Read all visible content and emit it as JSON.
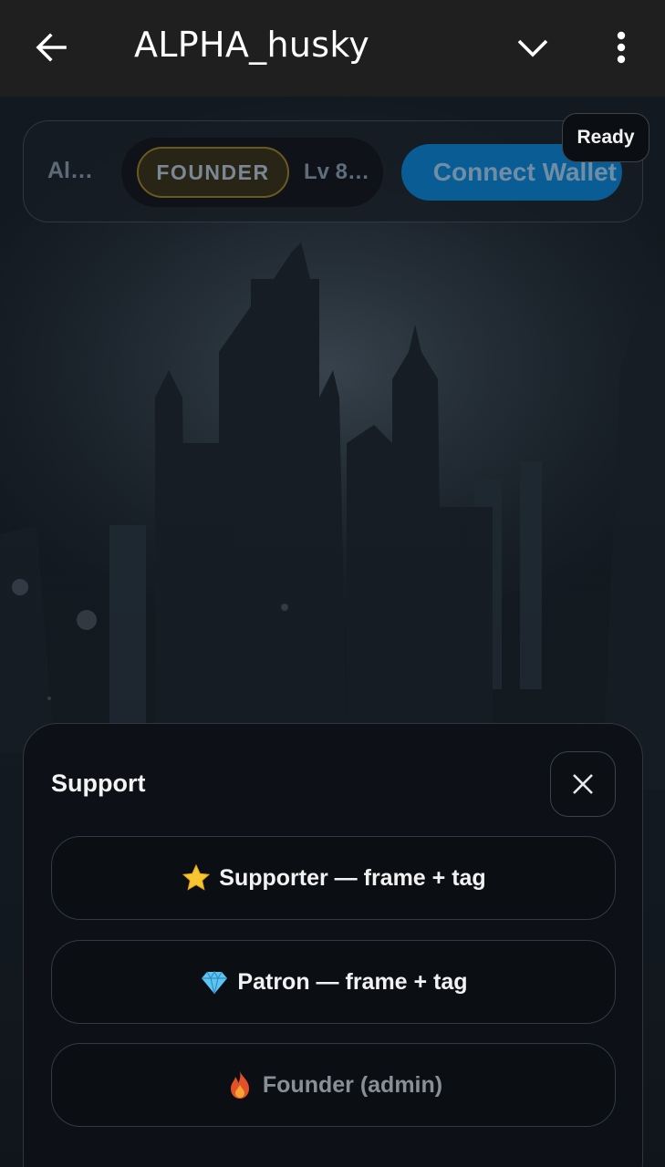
{
  "appbar": {
    "title": "ALPHA_husky",
    "icons": [
      "back-arrow-icon",
      "chevron-down-icon",
      "more-vert-icon"
    ]
  },
  "hud": {
    "player_name": "Al…",
    "badge": "FOUNDER",
    "level": "Lv 8…",
    "wallet_button": "Connect Wallet",
    "status": "Ready"
  },
  "support": {
    "title": "Support",
    "options": [
      {
        "icon": "star-icon",
        "label": "Supporter — frame + tag"
      },
      {
        "icon": "gem-icon",
        "label": "Patron — frame + tag"
      },
      {
        "icon": "fire-icon",
        "label": "Founder (admin)"
      }
    ]
  },
  "colors": {
    "appbar_bg": "#1f1f1f",
    "wallet_button": "#0a5d94",
    "founder_border": "#6b5a1f",
    "sheet_bg": "#0d1117"
  }
}
